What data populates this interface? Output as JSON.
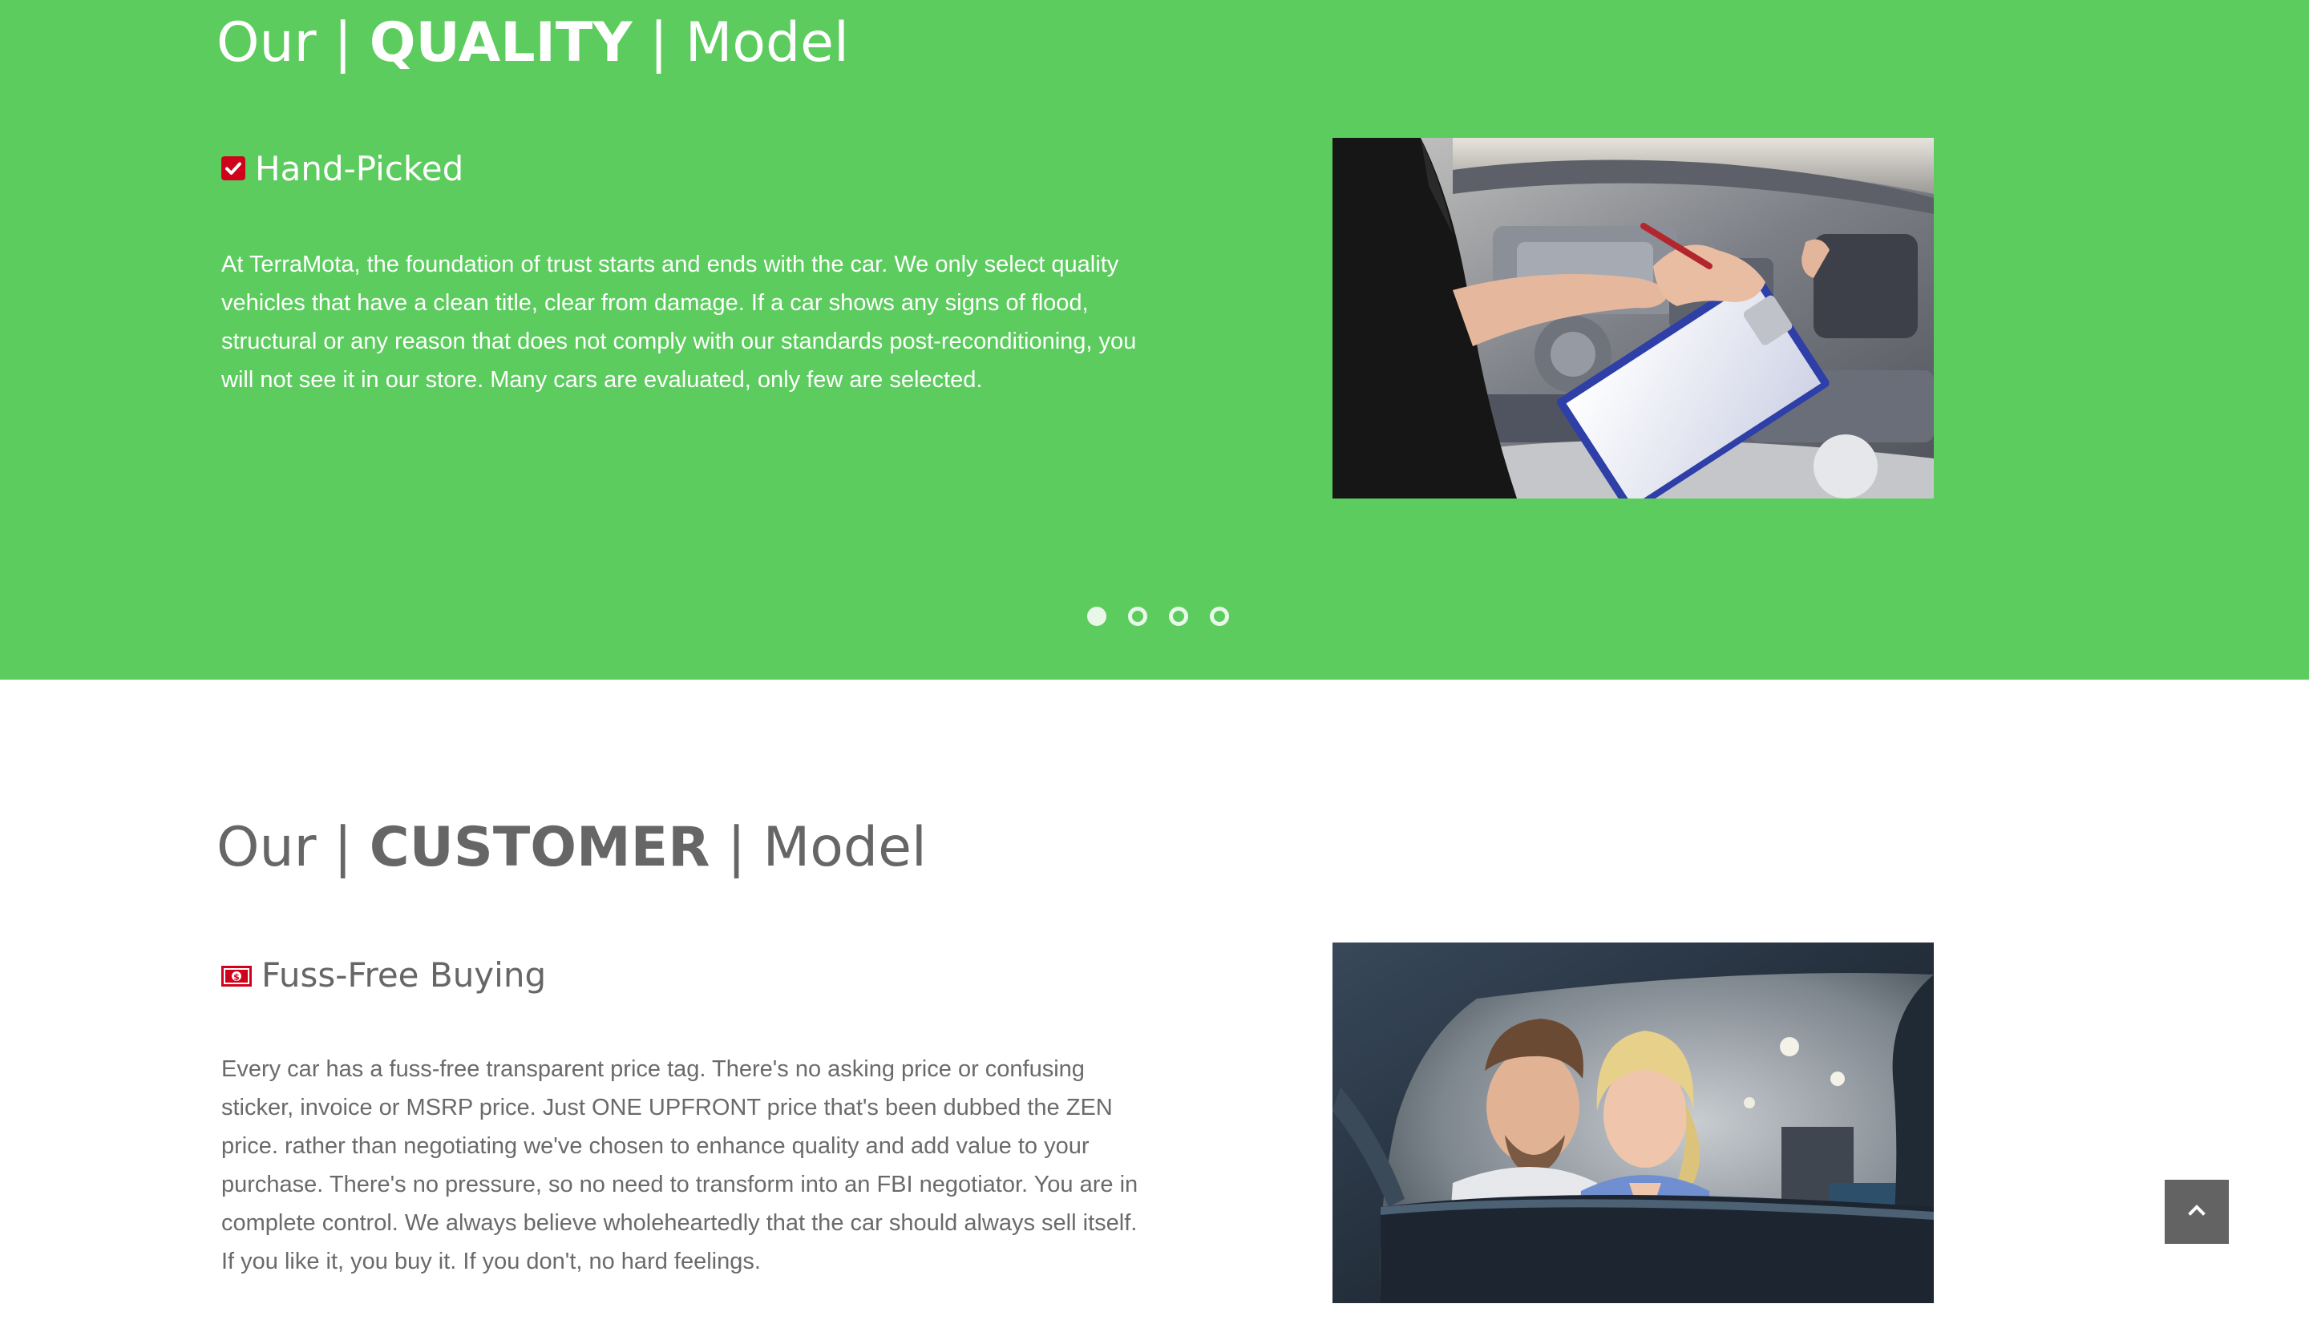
{
  "quality": {
    "heading": {
      "prefix": "Our | ",
      "emphasis": "QUALITY",
      "suffix": " | Model"
    },
    "feature": {
      "icon": "checkbox-icon",
      "title": "Hand-Picked",
      "body": "At TerraMota, the foundation of trust starts and ends with the car. We only select quality vehicles that have a clean title, clear from damage. If a car shows any signs of flood, structural or any reason that does not comply with our standards post-reconditioning, you will not see it in our store. Many cars are evaluated, only few are selected."
    },
    "carousel": {
      "slide_count": 4,
      "active_index": 0
    },
    "colors": {
      "background": "#5ccc5e",
      "icon": "#d0021b"
    }
  },
  "customer": {
    "heading": {
      "prefix": "Our | ",
      "emphasis": "CUSTOMER",
      "suffix": " | Model"
    },
    "feature": {
      "icon": "money-icon",
      "title": "Fuss-Free Buying",
      "body": "Every car has a fuss-free transparent price tag. There's no asking price or confusing sticker, invoice or MSRP price. Just ONE UPFRONT price that's been dubbed the ZEN price. rather than negotiating we've chosen to enhance quality and add value to your purchase. There's no pressure, so no need to transform into an FBI negotiator. You are in complete control. We always believe wholeheartedly that the car should always sell itself. If you like it, you buy it. If you don't, no hard feelings."
    },
    "colors": {
      "text": "#666666",
      "icon": "#d0021b"
    }
  },
  "back_to_top": {
    "icon": "chevron-up-icon"
  }
}
